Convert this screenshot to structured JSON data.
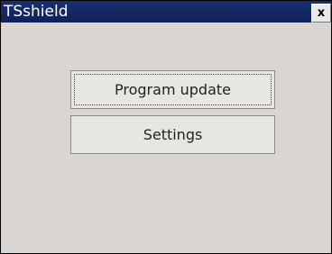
{
  "window": {
    "title": "TSshield",
    "close_label": "x"
  },
  "buttons": {
    "program_update": "Program update",
    "settings": "Settings"
  }
}
